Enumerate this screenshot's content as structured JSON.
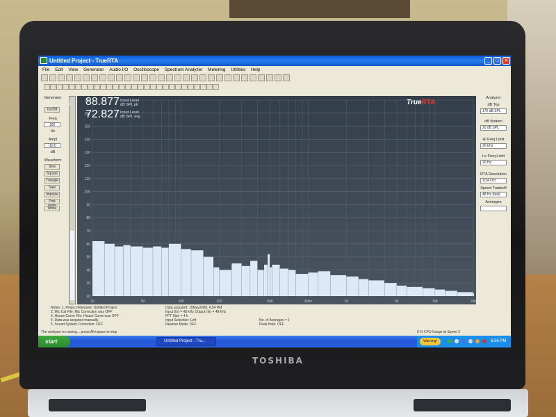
{
  "window": {
    "title": "Untitled Project - TrueRTA",
    "minimize": "_",
    "maximize": "□",
    "close": "✕"
  },
  "menu": [
    "File",
    "Edit",
    "View",
    "Generator",
    "Audio I/O",
    "Oscilloscope",
    "Spectrum Analyzer",
    "Metering",
    "Utilities",
    "Help"
  ],
  "readout": {
    "peak_value": "88.877",
    "peak_label_1": "Input Level",
    "peak_label_2": "dB SPL pk",
    "avg_value": "72.827",
    "avg_label_1": "Input Level",
    "avg_label_2": "dB SPL avg",
    "unit_small": "dB SPL"
  },
  "logo": {
    "part1": "True",
    "part2": "RTA"
  },
  "generator_panel": {
    "title": "Generator",
    "on_off": "On/Off",
    "freq_label": "Freq",
    "freq_value": "100",
    "freq_unit": "Hz",
    "ampl_label": "Ampl",
    "ampl_value": "-10.0",
    "ampl_unit": "dB",
    "wave_label": "Waveform",
    "waves": [
      "Sine",
      "Square",
      "Triangle",
      "Saw",
      "Impulse",
      "Pink noise",
      "White"
    ]
  },
  "analyzer_panel": {
    "title": "Analyzer",
    "db_top_label": "dB Top",
    "db_top_value": "170 dB SPL",
    "db_bottom_label": "dB Bottom",
    "db_bottom_value": "20 dB SPL",
    "hi_freq_label": "Hi Freq Limit",
    "hi_freq_value": "20 kHz",
    "lo_freq_label": "Lo Freq Limit",
    "lo_freq_value": "20 Hz",
    "rta_res_label": "RTA Resolution",
    "rta_res_value": "1/24 Oct",
    "speed_label": "Speed Tradeoff",
    "speed_value": "48 Hz (fast)",
    "averages_label": "Averages"
  },
  "notes": {
    "col1": [
      "Notes:  1. Project Filename: Untitled Project",
      "2. Mic Cal File: Mic Correction was OFF",
      "3. House Curve File: House Curve was OFF",
      "4. Data was acquired manually.",
      "5. Sound System Correction: OFF"
    ],
    "col2": [
      "Data acquired: 15May2008, 6:54 PM",
      "Input (fs) = 48 kHz   Output (fs) = 48 kHz",
      "FFT Size = 4 k",
      "Input Selection: Left",
      "Relative Mode: OFF"
    ],
    "col3": [
      "No. of Averages = 1",
      "Peak Hold: OFF"
    ]
  },
  "status": {
    "message": "The analyzer is running... press Alt+space to stop",
    "cpu": "0 % CPU Usage at Speed 2"
  },
  "taskbar": {
    "start": "start",
    "task": "Untitled Project - Tru...",
    "tray_warning": "Warning!",
    "clock": "6:56 PM"
  },
  "laptop": {
    "brand": "TOSHIBA"
  },
  "chart_data": {
    "type": "area",
    "y_ticks": [
      "170",
      "160",
      "150",
      "140",
      "130",
      "120",
      "110",
      "100",
      "90",
      "80",
      "70",
      "60",
      "50",
      "40",
      "30",
      "20"
    ],
    "x_ticks": [
      "20",
      "50",
      "100",
      "200",
      "500",
      "1kHz",
      "2k",
      "5k",
      "10k",
      "20k"
    ],
    "ylim": [
      20,
      170
    ],
    "xlim": [
      20,
      20000
    ],
    "x_scale": "log",
    "grid": true,
    "x": [
      20,
      25,
      30,
      35,
      40,
      50,
      60,
      70,
      80,
      100,
      120,
      150,
      180,
      200,
      250,
      300,
      350,
      400,
      450,
      480,
      500,
      520,
      600,
      700,
      800,
      1000,
      1200,
      1500,
      2000,
      2500,
      3000,
      4000,
      5000,
      6000,
      8000,
      10000,
      12000,
      15000,
      20000
    ],
    "y": [
      62,
      60,
      58,
      59,
      58,
      57,
      58,
      57,
      60,
      56,
      55,
      50,
      42,
      40,
      45,
      43,
      47,
      40,
      44,
      52,
      42,
      44,
      41,
      40,
      37,
      38,
      39,
      36,
      35,
      33,
      32,
      30,
      28,
      27,
      26,
      25,
      24,
      23,
      22
    ],
    "series": [
      {
        "color": "#dde9f6"
      }
    ]
  }
}
